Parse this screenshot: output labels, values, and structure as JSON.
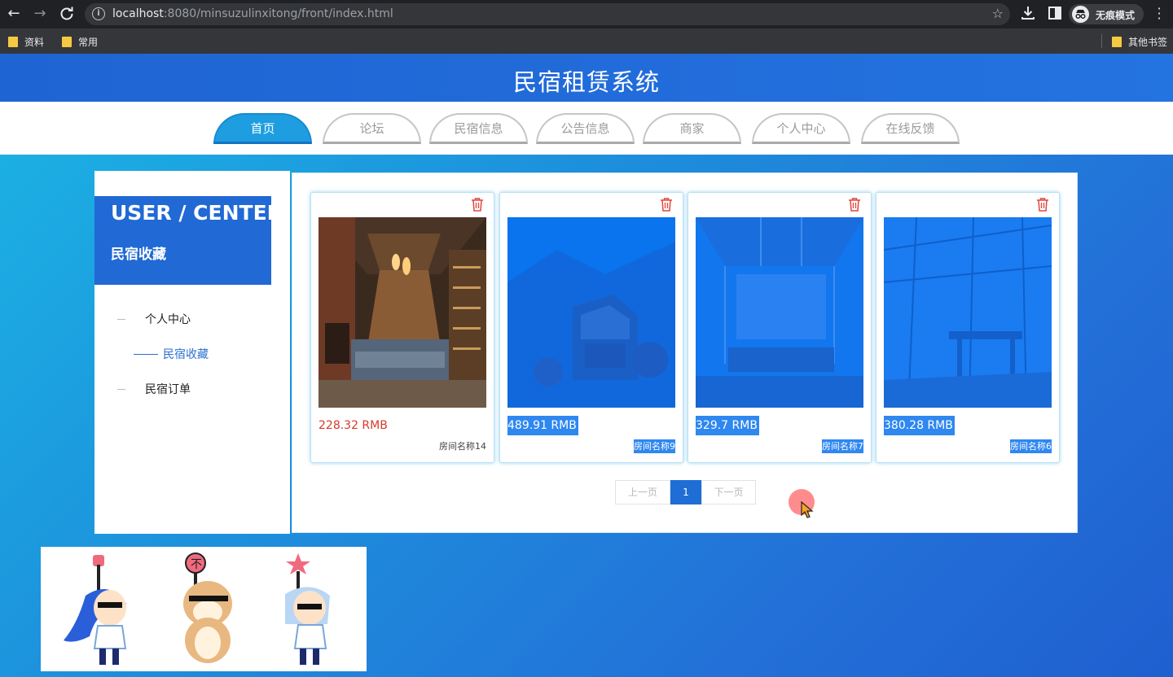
{
  "browser": {
    "url_host": "localhost",
    "url_rest": ":8080/minsuzulinxitong/front/index.html",
    "profile_label": "无痕模式",
    "bookmarks": [
      "资料",
      "常用"
    ],
    "other_bookmarks": "其他书签"
  },
  "site": {
    "title": "民宿租赁系统",
    "nav": [
      "首页",
      "论坛",
      "民宿信息",
      "公告信息",
      "商家",
      "个人中心",
      "在线反馈"
    ],
    "active_nav": "首页"
  },
  "sidebar": {
    "header_en": "USER / CENTER",
    "header_cn": "民宿收藏",
    "items": [
      {
        "label": "个人中心",
        "active": false
      },
      {
        "label": "民宿收藏",
        "active": true
      },
      {
        "label": "民宿订单",
        "active": false
      }
    ]
  },
  "favorites": [
    {
      "price": "228.32 RMB",
      "room": "房间名称14",
      "image": "warm lodge interior",
      "highlighted": false
    },
    {
      "price": "489.91 RMB",
      "room": "房间名称9",
      "image": "mountain village house",
      "highlighted": true
    },
    {
      "price": "329.7 RMB",
      "room": "房间名称7",
      "image": "sunroom lounge",
      "highlighted": true
    },
    {
      "price": "380.28 RMB",
      "room": "房间名称6",
      "image": "glass terrace cafe",
      "highlighted": true
    }
  ],
  "pagination": {
    "prev": "上一页",
    "current": "1",
    "next": "下一页"
  },
  "colors": {
    "header_blue": "#2169d4",
    "nav_active": "#1e9ee0",
    "price_red": "#d6392b",
    "selection_blue": "#2f87f0",
    "delete_icon": "#e0473d"
  },
  "icons": {
    "card_action": "trash-icon",
    "cursor": "mouse-pointer-icon"
  }
}
